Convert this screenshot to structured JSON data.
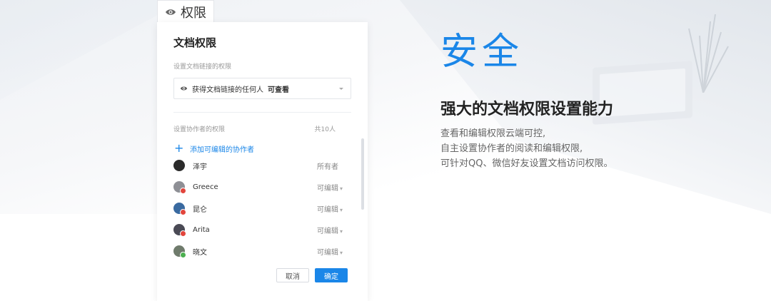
{
  "tab": {
    "label": "权限",
    "icon": "eye-icon"
  },
  "dialog": {
    "title": "文档权限",
    "link_section_label": "设置文档链接的权限",
    "link_select": {
      "text": "获得文档链接的任何人",
      "permission": "可查看"
    },
    "collab_section_label": "设置协作者的权限",
    "collab_count": "共10人",
    "add_collaborator": "添加可编辑的协作者",
    "members": [
      {
        "name": "泽宇",
        "permission": "所有者",
        "dropdown": false,
        "avatar_color": "#2b2b2b",
        "badge": ""
      },
      {
        "name": "Greece",
        "permission": "可编辑",
        "dropdown": true,
        "avatar_color": "#8e8f95",
        "badge": "red"
      },
      {
        "name": "昆仑",
        "permission": "可编辑",
        "dropdown": true,
        "avatar_color": "#3a6aa0",
        "badge": "red"
      },
      {
        "name": "Arita",
        "permission": "可编辑",
        "dropdown": true,
        "avatar_color": "#4a4a55",
        "badge": "red"
      },
      {
        "name": "晓文",
        "permission": "可编辑",
        "dropdown": true,
        "avatar_color": "#6f7b6c",
        "badge": "green"
      }
    ],
    "cancel_label": "取消",
    "ok_label": "确定"
  },
  "hero": {
    "title": "安全",
    "subtitle": "强大的文档权限设置能力",
    "lines": [
      "查看和编辑权限云端可控,",
      "自主设置协作者的阅读和编辑权限,",
      "可针对QQ、微信好友设置文档访问权限。"
    ]
  },
  "colors": {
    "accent": "#1a86e8",
    "badge_red": "#e2453c",
    "badge_green": "#4cb050"
  }
}
